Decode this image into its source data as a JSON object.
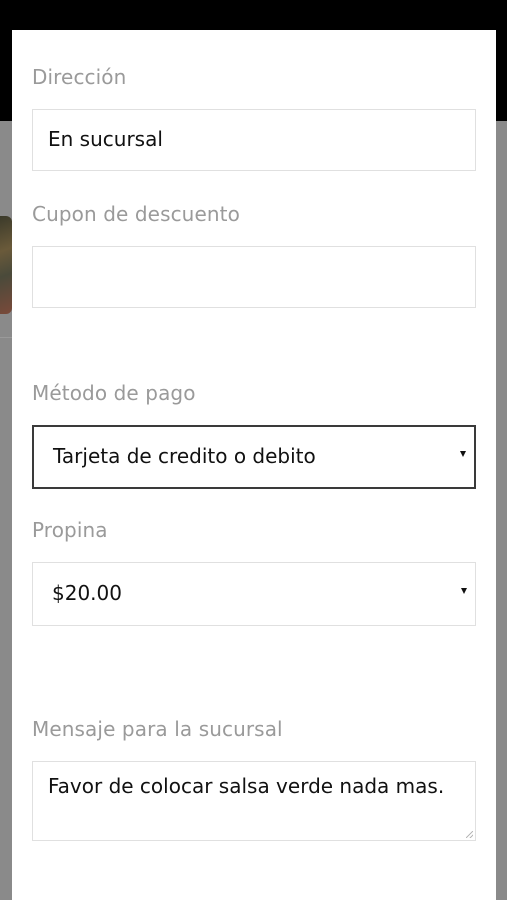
{
  "form": {
    "direccion": {
      "label": "Dirección",
      "value": "En sucursal"
    },
    "cupon": {
      "label": "Cupon de descuento",
      "value": ""
    },
    "metodo_pago": {
      "label": "Método de pago",
      "selected": "Tarjeta de credito o debito"
    },
    "propina": {
      "label": "Propina",
      "selected": "$20.00"
    },
    "mensaje": {
      "label": "Mensaje para la sucursal",
      "value": "Favor de colocar salsa verde nada mas."
    }
  },
  "icons": {
    "select_caret": "caret-down-icon",
    "resize": "resize-grip-icon"
  },
  "colors": {
    "label": "#9a9a9a",
    "text": "#111111",
    "field_border": "#e0e0e0",
    "active_border": "#3a3a3a",
    "overlay": "#808080",
    "topbar": "#000000"
  }
}
